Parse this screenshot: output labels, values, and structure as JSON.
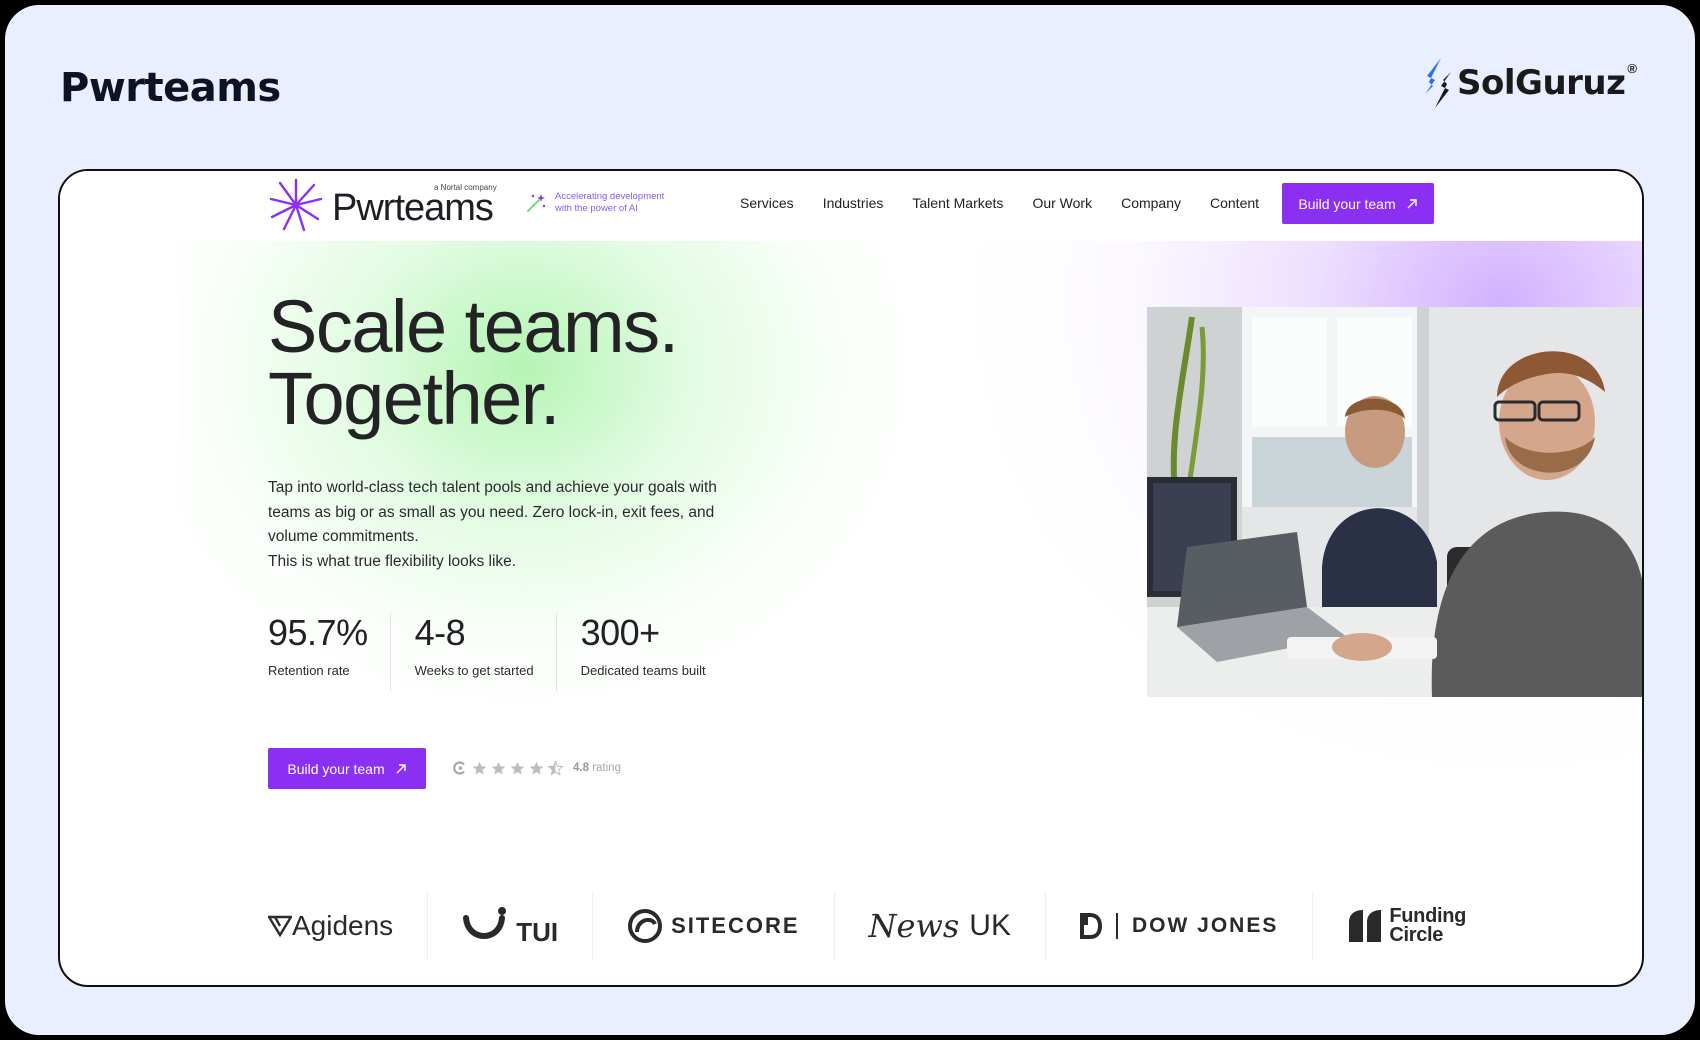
{
  "slide": {
    "title": "Pwrteams",
    "brand": "SolGuruz",
    "brand_mark": "®"
  },
  "nav": {
    "logo_text": "Pwrteams",
    "logo_sub": "a Nortal company",
    "tagline": "Accelerating development with the power of AI",
    "links": [
      "Services",
      "Industries",
      "Talent Markets",
      "Our Work",
      "Company",
      "Content"
    ],
    "cta_label": "Build your team"
  },
  "hero": {
    "headline_line1": "Scale teams.",
    "headline_line2": "Together.",
    "paragraph_line1": "Tap into world-class tech talent pools and achieve your goals with teams as big or as small as you need. Zero lock-in, exit fees, and volume commitments.",
    "paragraph_line2": "This is what true flexibility looks like.",
    "stats": [
      {
        "value": "95.7%",
        "label": "Retention rate"
      },
      {
        "value": "4-8",
        "label": "Weeks to get started"
      },
      {
        "value": "300+",
        "label": "Dedicated teams built"
      }
    ],
    "cta_label": "Build your team",
    "rating_value": "4.8",
    "rating_label": "rating",
    "rating_stars": 4.5
  },
  "partners": [
    "Agidens",
    "TUI",
    "SITECORE",
    "News",
    "UK",
    "DOW JONES",
    "Funding",
    "Circle"
  ],
  "colors": {
    "accent": "#8b2ff2",
    "slide_bg": "#e9efff",
    "tagline": "#8a5cf5"
  }
}
